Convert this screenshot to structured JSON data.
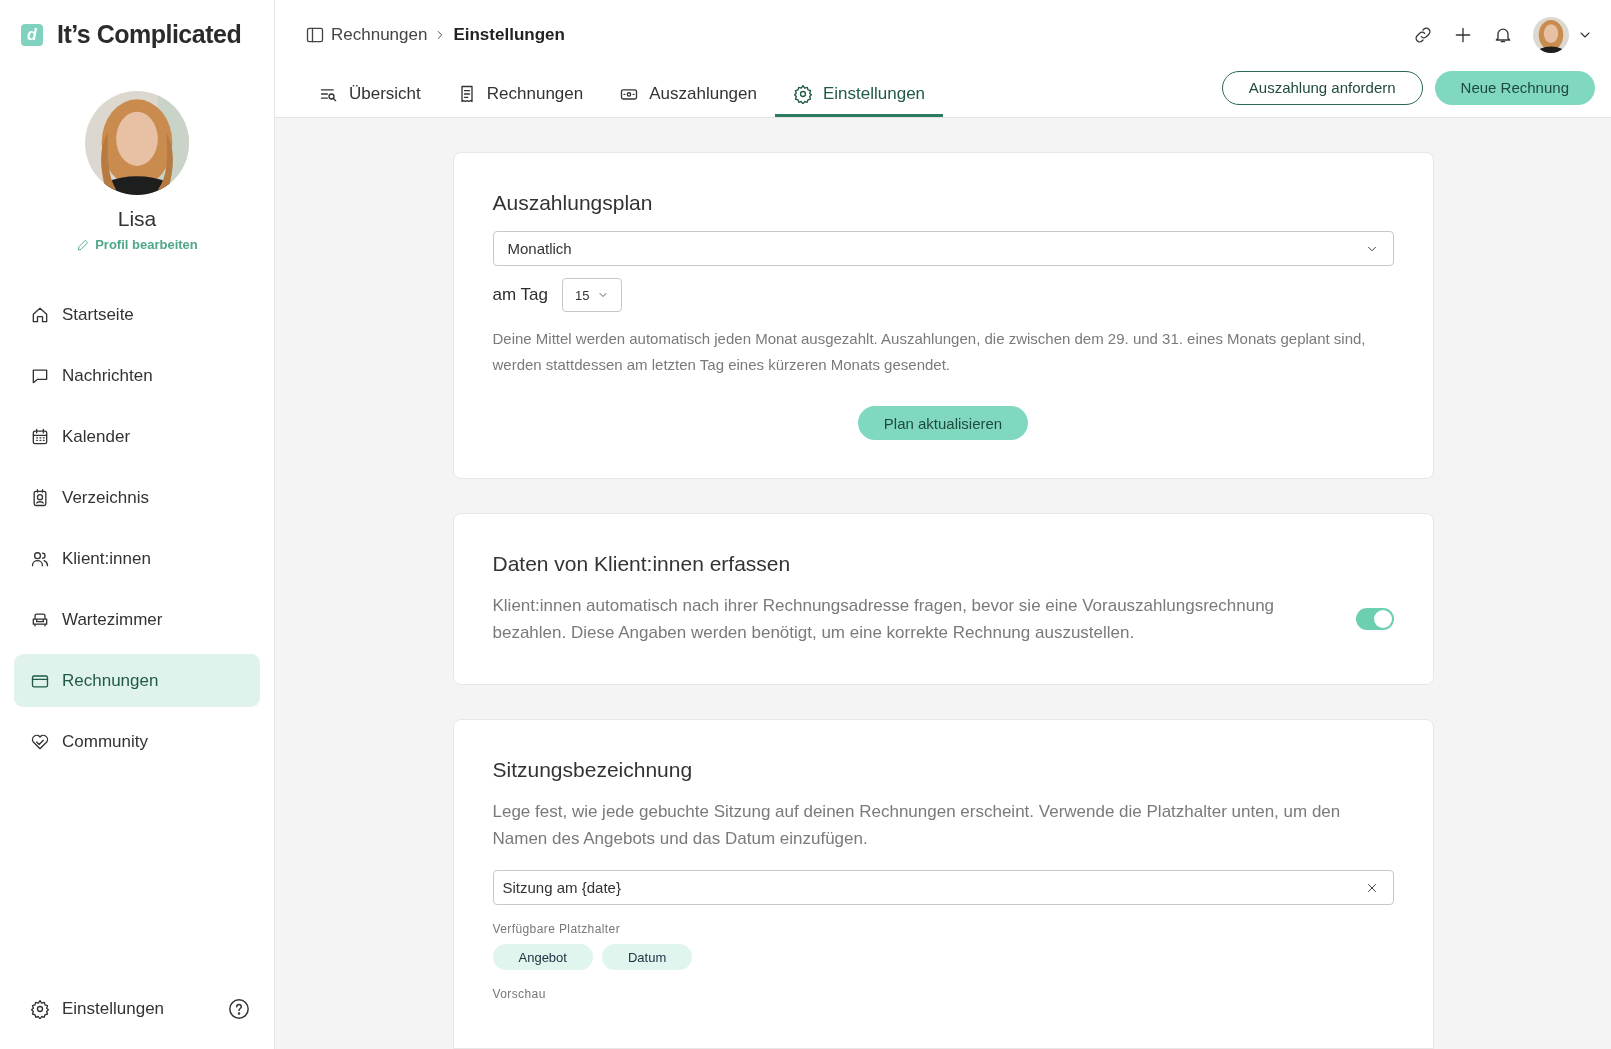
{
  "brand": {
    "logo_letter": "d",
    "name": "It’s Complicated"
  },
  "profile": {
    "name": "Lisa",
    "edit_link": "Profil bearbeiten"
  },
  "sidebar": {
    "items": [
      {
        "label": "Startseite",
        "selected": false
      },
      {
        "label": "Nachrichten",
        "selected": false
      },
      {
        "label": "Kalender",
        "selected": false
      },
      {
        "label": "Verzeichnis",
        "selected": false
      },
      {
        "label": "Klient:innen",
        "selected": false
      },
      {
        "label": "Wartezimmer",
        "selected": false
      },
      {
        "label": "Rechnungen",
        "selected": true
      },
      {
        "label": "Community",
        "selected": false
      }
    ],
    "footer_item": {
      "label": "Einstellungen"
    }
  },
  "breadcrumb": [
    "Rechnungen",
    "Einstellungen"
  ],
  "tabs": [
    {
      "label": "Übersicht",
      "selected": false
    },
    {
      "label": "Rechnungen",
      "selected": false
    },
    {
      "label": "Auszahlungen",
      "selected": false
    },
    {
      "label": "Einstellungen",
      "selected": true
    }
  ],
  "actions": [
    {
      "label": "Auszahlung anfordern",
      "kind": "outline"
    },
    {
      "label": "Neue Rechnung",
      "kind": "filled"
    }
  ],
  "payout_plan": {
    "title": "Auszahlungsplan",
    "frequency": "Monatlich",
    "day_label": "am Tag",
    "day": "15",
    "description": "Deine Mittel werden automatisch jeden Monat ausgezahlt. Auszahlungen, die zwischen dem 29. und 31. eines Monats geplant sind, werden stattdessen am letzten Tag eines kürzeren Monats gesendet.",
    "button": "Plan aktualisieren"
  },
  "client_data": {
    "title": "Daten von Klient:innen erfassen",
    "description": "Klient:innen automatisch nach ihrer Rechnungsadresse fragen, bevor sie eine Vorauszahlungsrechnung bezahlen. Diese Angaben werden benötigt, um eine korrekte Rechnung auszustellen.",
    "on": true
  },
  "session_label": {
    "title": "Sitzungsbezeichnung",
    "description": "Lege fest, wie jede gebuchte Sitzung auf deinen Rechnungen erscheint. Verwende die Platzhalter unten, um den Namen des Angebots und das Datum einzufügen.",
    "value": "Sitzung am {date}",
    "placeholders_label": "Verfügbare Platzhalter",
    "placeholders": [
      "Angebot",
      "Datum"
    ],
    "preview_label": "Vorschau"
  }
}
